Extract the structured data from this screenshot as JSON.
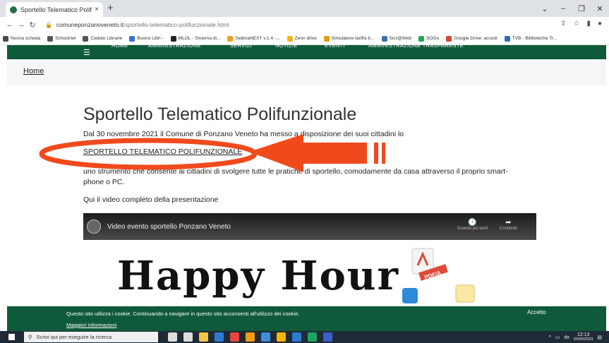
{
  "browser": {
    "tab_title": "Sportello Telematico Polifunzionale",
    "tab_close": "×",
    "new_tab": "+",
    "url_domain": "comuneponzanoveneto.it",
    "url_path": "/sportello-telematico-polifunzionale.html",
    "bookmarks": [
      {
        "label": "Nuova scheda",
        "color": "#4a4a4a"
      },
      {
        "label": "Schoolnet",
        "color": "#555555"
      },
      {
        "label": "Cedole Librarie",
        "color": "#555555"
      },
      {
        "label": "Buono Libri -",
        "color": "#3a6fd8"
      },
      {
        "label": "MLOL - Sistema di...",
        "color": "#222222"
      },
      {
        "label": "SebinaNEXT v.1.4 -...",
        "color": "#f0a020"
      },
      {
        "label": "Zeon drive",
        "color": "#f5b21b"
      },
      {
        "label": "Simulatore tariffa tr...",
        "color": "#e89a10"
      },
      {
        "label": "Sicr@Web",
        "color": "#3d6fb0"
      },
      {
        "label": "SOGo",
        "color": "#1fa84f"
      },
      {
        "label": "Google Drive: accedi",
        "color": "#db4437"
      },
      {
        "label": "TVB - Biblioteche Tr...",
        "color": "#2b6cb0"
      }
    ]
  },
  "site": {
    "nav": [
      "HOME",
      "AMMINISTRAZIONE",
      "SERVIZI",
      "NOTIZIE",
      "EVENTI",
      "AMMINISTRAZIONE TRASPARENTE"
    ],
    "breadcrumb": "Home",
    "title": "Sportello Telematico Polifunzionale",
    "para1": "Dal 30 novembre 2021 il Comune di Ponzano Veneto ha messo a disposizione dei suoi cittadini lo",
    "link": "SPORTELLO TELEMATICO POLIFUNZIONALE",
    "para2": "uno strumento che consente ai cittadini di svolgere tutte le pratiche di sportello, comodamente da casa attraverso il proprio smart-phone o PC.",
    "para3": "Qui il video completo della presentazione"
  },
  "video": {
    "title": "Video evento sportello Ponzano Veneto",
    "watch_later": "Guarda più tardi",
    "share": "Condividi",
    "thumbnail_text": "Happy Hour",
    "pdf_label": "PDF/A"
  },
  "cookie": {
    "text": "Questo sito utilizza i cookie. Continuando a navigare in questo sito acconsenti all'utilizzo dei cookie.",
    "info": "Maggiori informazioni",
    "accept": "Accetto"
  },
  "taskbar": {
    "search_placeholder": "Scrivi qui per eseguire la ricerca",
    "time": "12:13",
    "date": "03/05/2023",
    "lang": "dx",
    "apps": [
      "#dddddd",
      "#dddddd",
      "#f2c744",
      "#2e7bd6",
      "#e8453c",
      "#f39c12",
      "#3c8fd8",
      "#f7b500",
      "#2b7cd3",
      "#1fa463",
      "#3a5fc8"
    ]
  },
  "annotation_color": "#f04a1c"
}
